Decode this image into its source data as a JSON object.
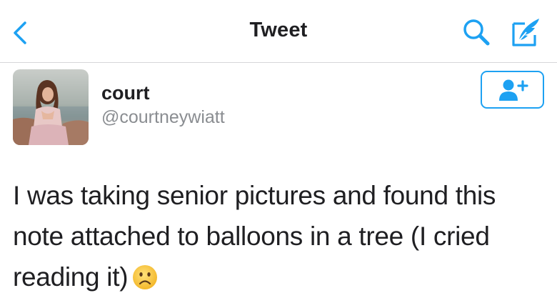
{
  "navbar": {
    "title": "Tweet",
    "back_icon": "chevron-left-icon",
    "search_icon": "search-icon",
    "compose_icon": "compose-feather-icon",
    "accent_color": "#1da1f2"
  },
  "tweet": {
    "author": {
      "display_name": "court",
      "handle": "@courtneywiatt",
      "avatar_icon": "avatar-photo"
    },
    "follow_icon": "add-user-icon",
    "text": "I was taking senior pictures and found this note attached to balloons in a tree (I cried reading it)",
    "emoji": "slightly-frowning-face-emoji"
  }
}
